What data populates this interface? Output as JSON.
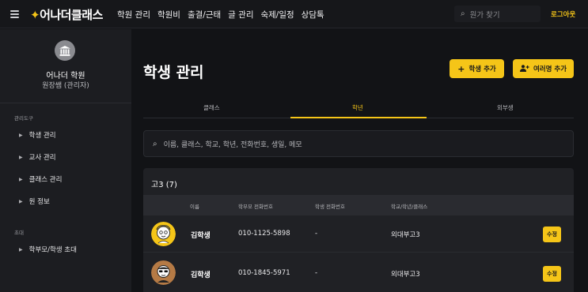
{
  "header": {
    "logo": "어나더클래스",
    "nav": [
      "학원 관리",
      "학원비",
      "출결/근태",
      "글 관리",
      "숙제/일정",
      "상담톡"
    ],
    "search_placeholder": "원가 찾기",
    "logout": "로그아웃"
  },
  "sidebar": {
    "academy_name": "어나더 학원",
    "role": "원장쌤 (관리자)",
    "section_tools": "관리도구",
    "tools": [
      "학생 관리",
      "교사 관리",
      "클래스 관리",
      "원 정보"
    ],
    "section_invite": "초대",
    "invite": [
      "학부모/학생 초대"
    ]
  },
  "main": {
    "title": "학생 관리",
    "add_student": "학생 추가",
    "add_multiple": "여러명 추가",
    "tabs": [
      "클래스",
      "학년",
      "외부생"
    ],
    "active_tab": "학년",
    "search_placeholder": "이름, 클래스, 학교, 학년, 전화번호, 생일, 메모",
    "group_title": "고3 (7)",
    "columns": [
      "이름",
      "학부모 전화번호",
      "학생 전화번호",
      "학교/학년/클래스"
    ],
    "rows": [
      {
        "name": "김학생",
        "parent_phone": "010-1125-5898",
        "student_phone": "-",
        "school": "외대부고3",
        "edit": "수정"
      },
      {
        "name": "김학생",
        "parent_phone": "010-1845-5971",
        "student_phone": "-",
        "school": "외대부고3",
        "edit": "수정"
      }
    ]
  },
  "colors": {
    "accent": "#f5c518",
    "background": "#121316",
    "sidebar": "#1c1d21"
  }
}
